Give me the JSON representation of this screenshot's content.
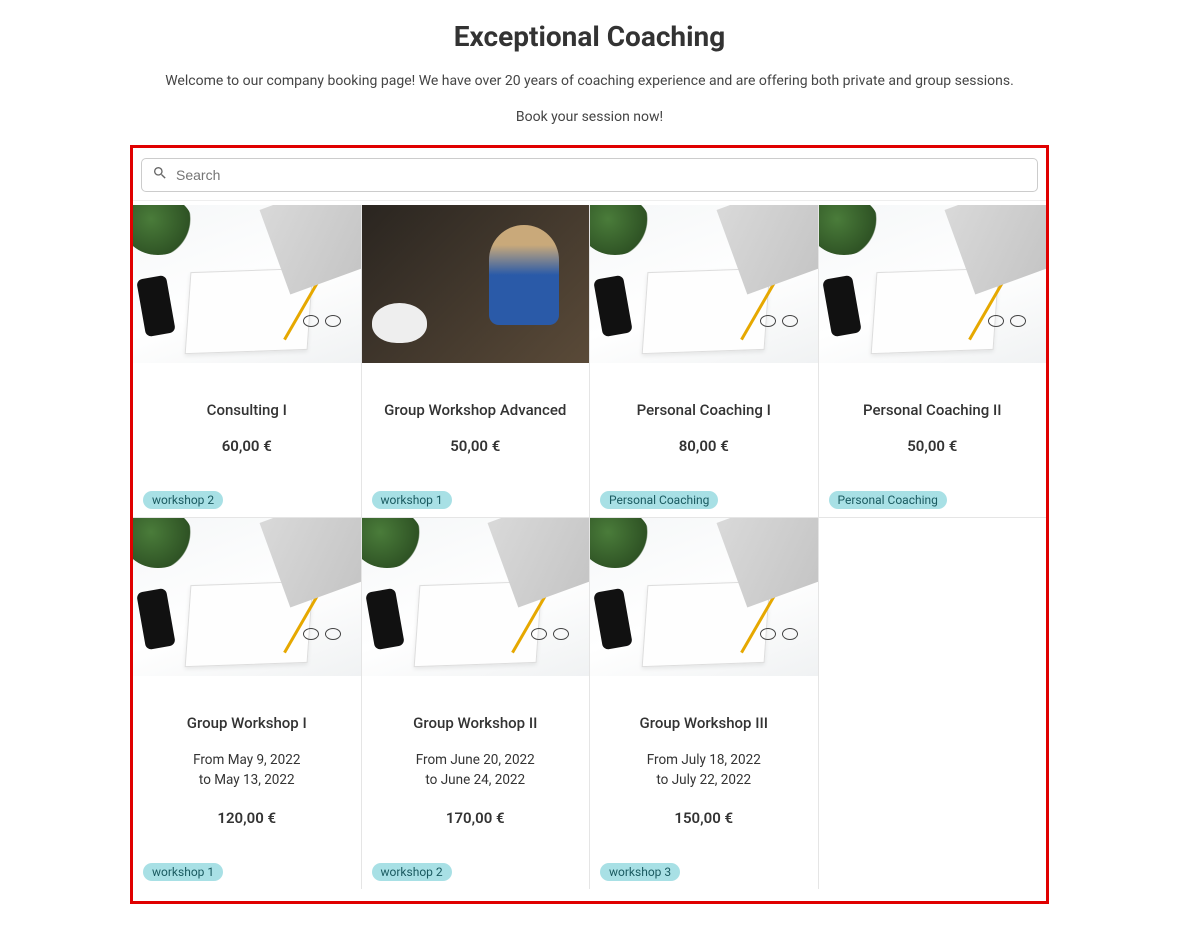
{
  "header": {
    "title": "Exceptional Coaching",
    "intro": "Welcome to our company booking page! We have over 20 years of coaching experience and are offering both private and group sessions.",
    "cta": "Book your session now!"
  },
  "search": {
    "placeholder": "Search"
  },
  "cards": [
    {
      "title": "Consulting I",
      "price": "60,00 €",
      "tag": "workshop 2",
      "dateFrom": "",
      "dateTo": "",
      "img": "desk"
    },
    {
      "title": "Group Workshop Advanced",
      "price": "50,00 €",
      "tag": "workshop 1",
      "dateFrom": "",
      "dateTo": "",
      "img": "people"
    },
    {
      "title": "Personal Coaching I",
      "price": "80,00 €",
      "tag": "Personal Coaching",
      "dateFrom": "",
      "dateTo": "",
      "img": "desk"
    },
    {
      "title": "Personal Coaching II",
      "price": "50,00 €",
      "tag": "Personal Coaching",
      "dateFrom": "",
      "dateTo": "",
      "img": "desk"
    },
    {
      "title": "Group Workshop I",
      "price": "120,00 €",
      "tag": "workshop 1",
      "dateFrom": "From May 9, 2022",
      "dateTo": "to May 13, 2022",
      "img": "desk"
    },
    {
      "title": "Group Workshop II",
      "price": "170,00 €",
      "tag": "workshop 2",
      "dateFrom": "From June 20, 2022",
      "dateTo": "to June 24, 2022",
      "img": "desk"
    },
    {
      "title": "Group Workshop III",
      "price": "150,00 €",
      "tag": "workshop 3",
      "dateFrom": "From July 18, 2022",
      "dateTo": "to July 22, 2022",
      "img": "desk"
    }
  ]
}
